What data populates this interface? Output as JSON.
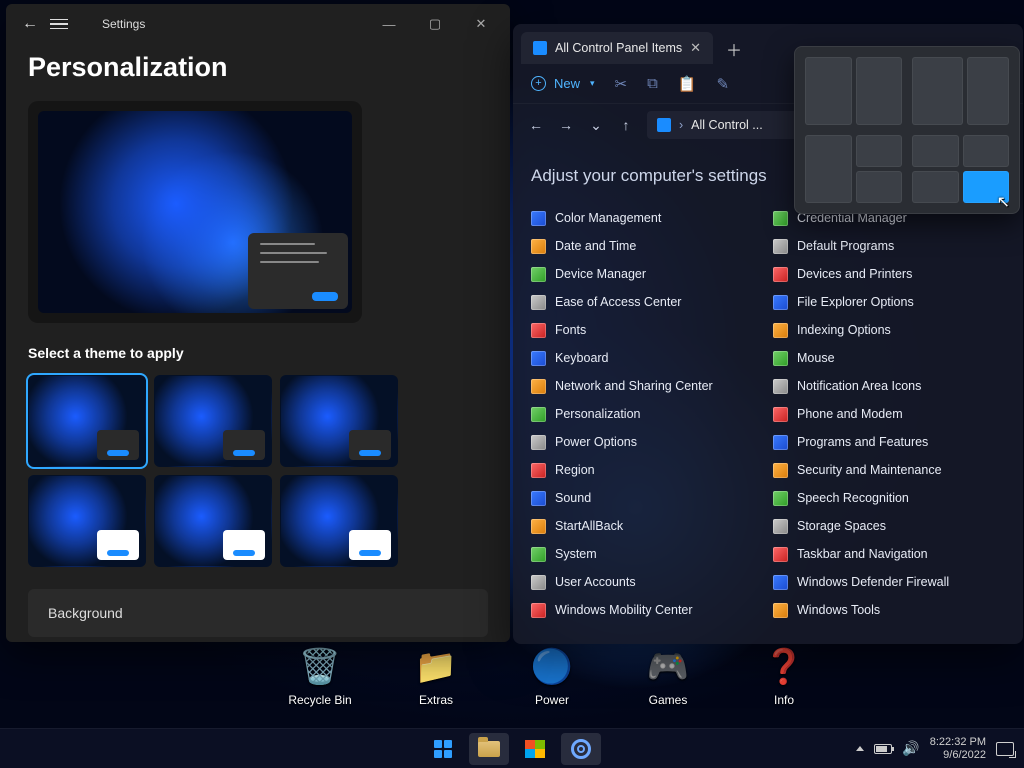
{
  "settings": {
    "app_name": "Settings",
    "page_title": "Personalization",
    "theme_heading": "Select a theme to apply",
    "rows": {
      "background": "Background"
    }
  },
  "explorer": {
    "tab_title": "All Control Panel Items",
    "toolbar": {
      "new": "New"
    },
    "breadcrumb": "All Control ...",
    "content_heading": "Adjust your computer's settings",
    "items_left": [
      "Color Management",
      "Date and Time",
      "Device Manager",
      "Ease of Access Center",
      "Fonts",
      "Keyboard",
      "Network and Sharing Center",
      "Personalization",
      "Power Options",
      "Region",
      "Sound",
      "StartAllBack",
      "System",
      "User Accounts",
      "Windows Mobility Center"
    ],
    "items_right": [
      "Credential Manager",
      "Default Programs",
      "Devices and Printers",
      "File Explorer Options",
      "Indexing Options",
      "Mouse",
      "Notification Area Icons",
      "Phone and Modem",
      "Programs and Features",
      "Security and Maintenance",
      "Speech Recognition",
      "Storage Spaces",
      "Taskbar and Navigation",
      "Windows Defender Firewall",
      "Windows Tools"
    ]
  },
  "desktop_icons": {
    "recycle": "Recycle Bin",
    "extras": "Extras",
    "power": "Power",
    "games": "Games",
    "info": "Info"
  },
  "taskbar": {
    "time": "8:22:32 PM",
    "date": "9/6/2022"
  }
}
